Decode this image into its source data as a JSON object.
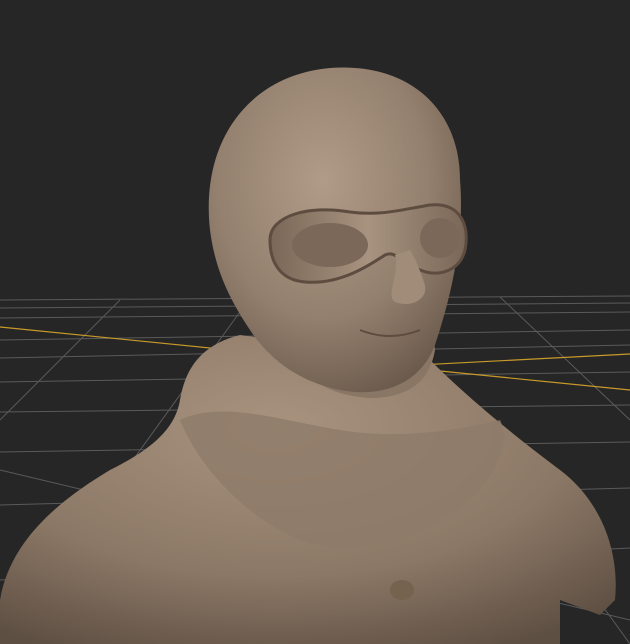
{
  "viewport": {
    "background_color": "#262626",
    "grid_color": "#5a5a5a",
    "axis_color": "#c89a2a",
    "model_color": "#9c8876",
    "model_name_icon": "sculpted-bust-aviator"
  }
}
